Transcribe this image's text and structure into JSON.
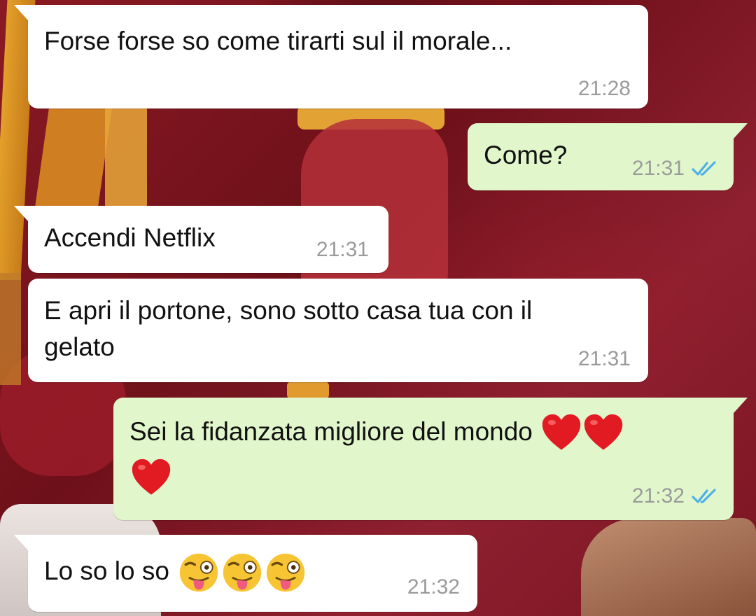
{
  "chat": {
    "messages": [
      {
        "direction": "incoming",
        "lines": [
          "Forse forse so come tirarti sul il morale..."
        ],
        "time": "21:28",
        "status": ""
      },
      {
        "direction": "outgoing",
        "lines": [
          "Come?"
        ],
        "time": "21:31",
        "status": "read"
      },
      {
        "direction": "incoming",
        "lines": [
          "Accendi Netflix"
        ],
        "time": "21:31",
        "status": ""
      },
      {
        "direction": "incoming",
        "lines": [
          "E apri il portone, sono sotto casa tua con il",
          "gelato"
        ],
        "time": "21:31",
        "status": ""
      },
      {
        "direction": "outgoing",
        "lines": [
          "Sei la fidanzata migliore del mondo"
        ],
        "emoji": [
          "red-heart",
          "red-heart",
          "red-heart"
        ],
        "time": "21:32",
        "status": "read"
      },
      {
        "direction": "incoming",
        "lines": [
          "Lo so lo so"
        ],
        "emoji": [
          "winking-face-with-tongue",
          "winking-face-with-tongue",
          "winking-face-with-tongue"
        ],
        "time": "21:32",
        "status": ""
      }
    ]
  },
  "colors": {
    "incoming_bubble": "#ffffff",
    "outgoing_bubble": "#e1f7cb",
    "read_ticks": "#4fb0e8",
    "timestamp": "#9a9a9a"
  },
  "icons": {
    "read_receipt": "double-check-icon",
    "heart_emoji": "red-heart-icon",
    "face_emoji": "winking-face-with-tongue-icon"
  }
}
